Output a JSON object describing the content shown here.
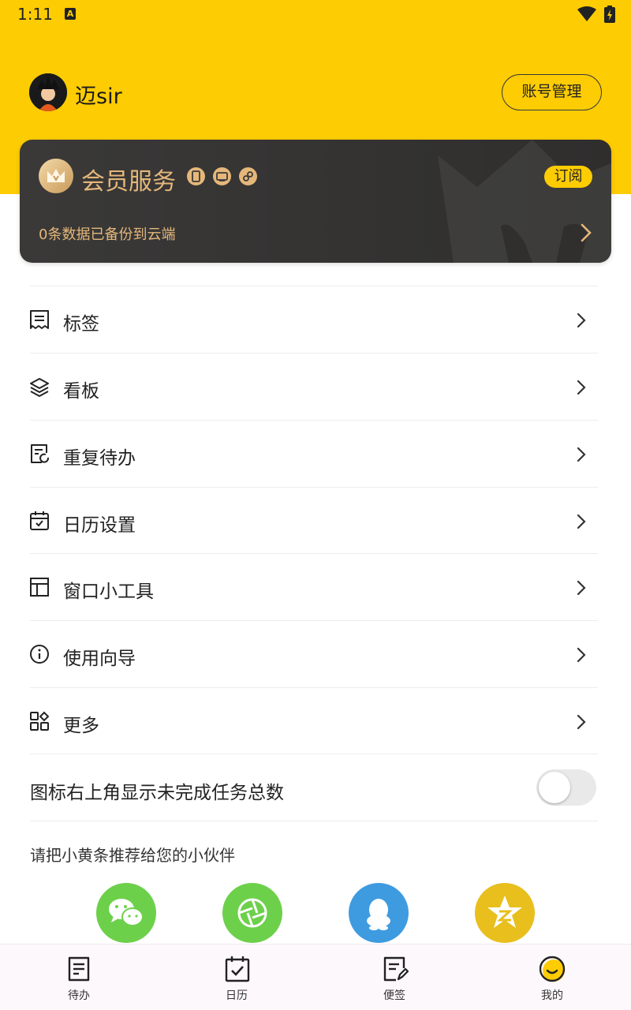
{
  "status_bar": {
    "time": "1:11"
  },
  "profile": {
    "username": "迈sir",
    "account_button": "账号管理"
  },
  "member_card": {
    "title": "会员服务",
    "subscribe_label": "订阅",
    "backup_text": "0条数据已备份到云端",
    "accent_color": "#E5B77A"
  },
  "menu": {
    "items": [
      {
        "label": "标签",
        "icon": "tag-list-icon"
      },
      {
        "label": "看板",
        "icon": "layers-icon"
      },
      {
        "label": "重复待办",
        "icon": "repeat-todo-icon"
      },
      {
        "label": "日历设置",
        "icon": "calendar-check-icon"
      },
      {
        "label": "窗口小工具",
        "icon": "widget-layout-icon"
      },
      {
        "label": "使用向导",
        "icon": "info-icon"
      },
      {
        "label": "更多",
        "icon": "grid-more-icon"
      }
    ],
    "toggle_label": "图标右上角显示未完成任务总数",
    "toggle_on": false
  },
  "share": {
    "title": "请把小黄条推荐给您的小伙伴",
    "targets": [
      {
        "icon": "wechat-icon",
        "color": "#6DD04B"
      },
      {
        "icon": "moments-icon",
        "color": "#6DD04B"
      },
      {
        "icon": "qq-icon",
        "color": "#3E9BE0"
      },
      {
        "icon": "qzone-icon",
        "color": "#E8BF1C"
      }
    ]
  },
  "bottom_nav": {
    "items": [
      {
        "label": "待办"
      },
      {
        "label": "日历"
      },
      {
        "label": "便签"
      },
      {
        "label": "我的"
      }
    ]
  },
  "colors": {
    "brand_yellow": "#FECC02",
    "card_dark": "#343332"
  }
}
